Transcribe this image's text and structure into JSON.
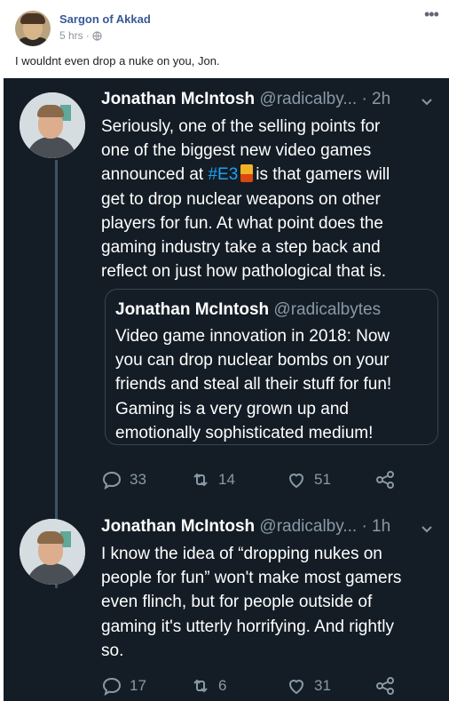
{
  "post": {
    "author": "Sargon of Akkad",
    "time": "5 hrs",
    "separator": "·",
    "more_icon": "more-icon",
    "text": "I wouldnt even drop a nuke on you, Jon."
  },
  "tweet1": {
    "name": "Jonathan McIntosh",
    "handle": "@radicalby...",
    "time": "· 2h",
    "line1": "Seriously, one of the selling points for",
    "line2": "one of the biggest new video games",
    "line3_pre": "announced at",
    "hashtag": "#E3",
    "line3_post": "is that gamers will",
    "line4": "get to drop nuclear weapons on other",
    "line5": "players for fun. At what point does the",
    "line6": "gaming industry take a step back and",
    "line7": "reflect on just how pathological that is.",
    "quote": {
      "name": "Jonathan McIntosh",
      "handle": "@radicalbytes",
      "lines": [
        "Video game innovation in 2018: Now",
        "you can drop nuclear bombs on your",
        "friends and steal all their stuff for fun!",
        "Gaming is a very grown up and",
        "emotionally sophisticated medium!"
      ]
    },
    "replies": "33",
    "retweets": "14",
    "likes": "51"
  },
  "tweet2": {
    "name": "Jonathan McIntosh",
    "handle": "@radicalby...",
    "time": "· 1h",
    "lines": [
      "I know the idea of “dropping nukes on",
      "people for fun” won't make most gamers",
      "even flinch, but for people outside of",
      "gaming it's utterly horrifying. And rightly",
      "so."
    ],
    "replies": "17",
    "retweets": "6",
    "likes": "31"
  },
  "colors": {
    "fb_link": "#385898",
    "twitter_bg": "#141d26",
    "twitter_blue": "#1da1f2",
    "muted": "#8899a6"
  }
}
